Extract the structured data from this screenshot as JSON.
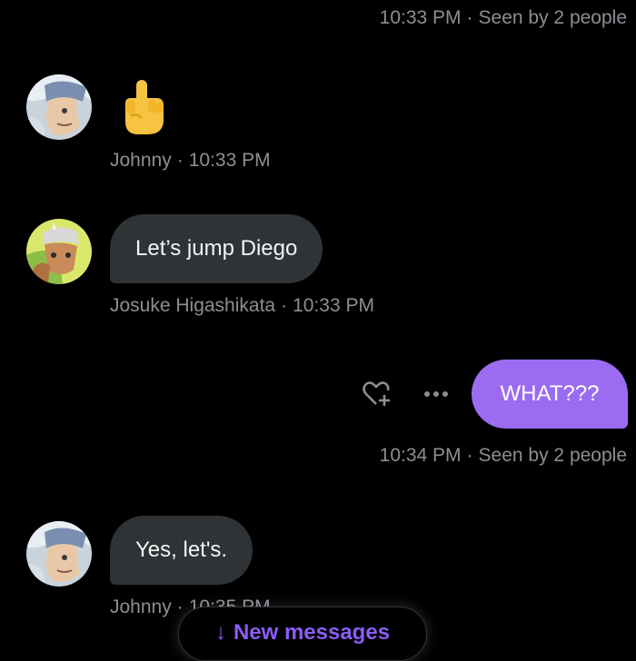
{
  "messages": [
    {
      "time": "10:33 PM",
      "seen": "Seen by 2 people"
    },
    {
      "sender": "Johnny",
      "time": "10:33 PM",
      "content": "emoji",
      "emoji": "middle-finger-emoji"
    },
    {
      "sender": "Josuke Higashikata",
      "time": "10:33 PM",
      "text": "Let’s jump Diego"
    },
    {
      "text": "WHAT???",
      "time": "10:34 PM",
      "seen": "Seen by 2 people"
    },
    {
      "sender": "Johnny",
      "time": "10:35 PM",
      "text": "Yes, let's."
    }
  ],
  "new_messages_label": "New messages",
  "icons": {
    "react": "heart-plus-icon",
    "more": "more-dots-icon",
    "new_messages": "arrow-down-icon"
  },
  "colors": {
    "background": "#000000",
    "incoming_bubble": "#2f3336",
    "outgoing_bubble": "#9b6cf2",
    "meta_text": "#8b8f94",
    "accent": "#8b5cf6"
  }
}
